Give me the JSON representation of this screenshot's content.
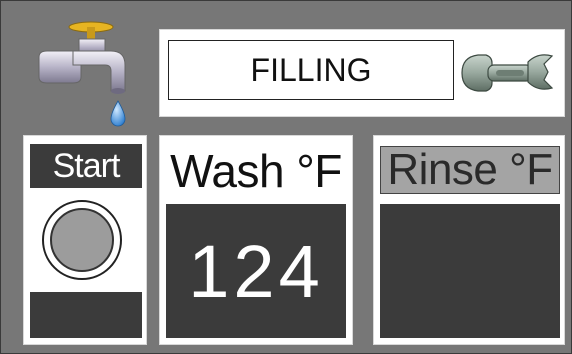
{
  "status": {
    "text": "FILLING"
  },
  "icons": {
    "faucet": "water-faucet-icon",
    "wrench": "wrench-icon"
  },
  "start": {
    "label": "Start",
    "indicator_color": "#9c9c9c"
  },
  "wash": {
    "title": "Wash °F",
    "value": "124"
  },
  "rinse": {
    "title": "Rinse °F",
    "value": ""
  },
  "colors": {
    "background": "#777777",
    "panel": "#ffffff",
    "display": "#3b3b3b",
    "rinse_title_bg": "#a4a4a4",
    "faucet_handle": "#e6b422",
    "water_drop": "#3a8fd8"
  }
}
